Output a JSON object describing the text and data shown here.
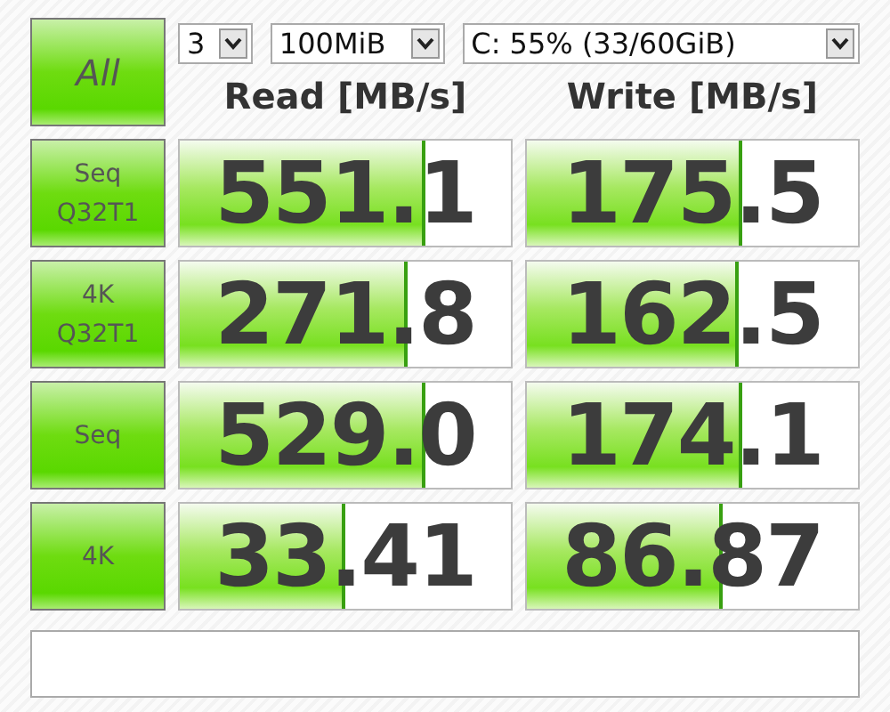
{
  "all_button": {
    "label": "All"
  },
  "selects": [
    {
      "value": "3"
    },
    {
      "value": "100MiB"
    },
    {
      "value": "C: 55% (33/60GiB)"
    }
  ],
  "headers": [
    "Read [MB/s]",
    "Write [MB/s]"
  ],
  "rows": [
    {
      "label": "Seq Q32T1",
      "read": {
        "value": "551.1",
        "level": 0.73
      },
      "write": {
        "value": "175.5",
        "level": 0.64
      }
    },
    {
      "label": "4K Q32T1",
      "read": {
        "value": "271.8",
        "level": 0.68
      },
      "write": {
        "value": "162.5",
        "level": 0.63
      }
    },
    {
      "label": "Seq",
      "read": {
        "value": "529.0",
        "level": 0.73
      },
      "write": {
        "value": "174.1",
        "level": 0.64
      }
    },
    {
      "label": "4K",
      "read": {
        "value": "33.41",
        "level": 0.49
      },
      "write": {
        "value": "86.87",
        "level": 0.58
      }
    }
  ]
}
